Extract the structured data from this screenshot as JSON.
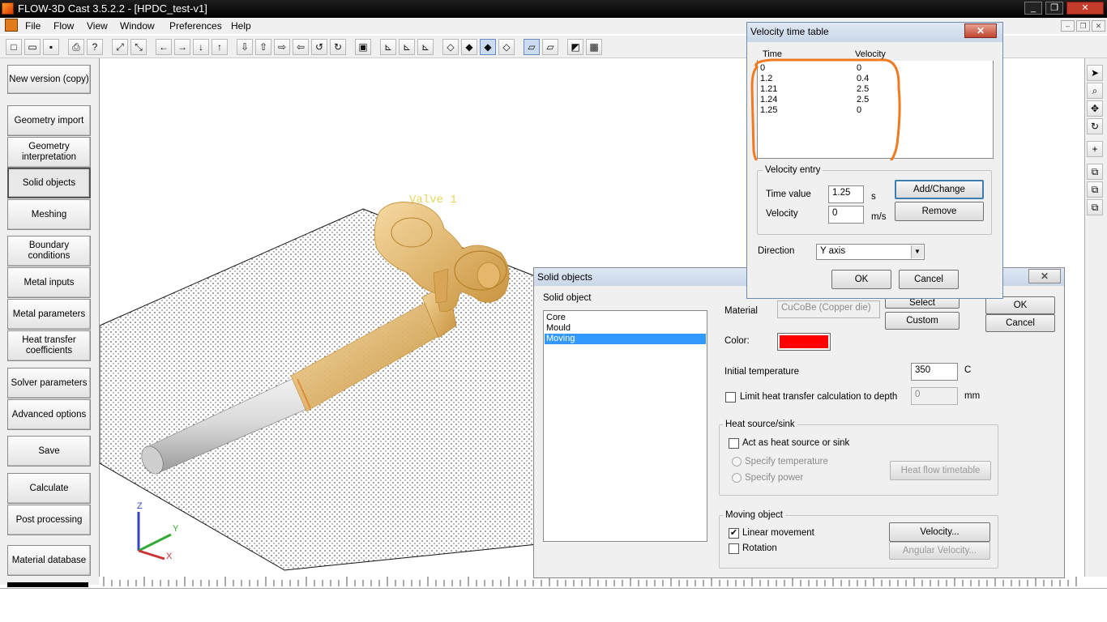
{
  "window": {
    "title": "FLOW-3D Cast 3.5.2.2 - [HPDC_test-v1]"
  },
  "menu": [
    "File",
    "Flow",
    "View",
    "Window",
    "Preferences",
    "Help"
  ],
  "left_panel": {
    "buttons": [
      "New version (copy)",
      "Geometry import",
      "Geometry interpretation",
      "Solid objects",
      "Meshing",
      "Boundary conditions",
      "Metal inputs",
      "Metal parameters",
      "Heat transfer coefficients",
      "Solver parameters",
      "Advanced options",
      "Save",
      "Calculate",
      "Post processing",
      "Material database"
    ],
    "active": "Solid objects"
  },
  "viewport": {
    "label": "Valve 1",
    "axes": {
      "z": "Z",
      "y": "Y",
      "x": "X"
    }
  },
  "velocity_dialog": {
    "title": "Velocity time table",
    "close": "✕",
    "headers": {
      "time": "Time",
      "velocity": "Velocity"
    },
    "rows": [
      {
        "time": "0",
        "velocity": "0"
      },
      {
        "time": "1.2",
        "velocity": "0.4"
      },
      {
        "time": "1.21",
        "velocity": "2.5"
      },
      {
        "time": "1.24",
        "velocity": "2.5"
      },
      {
        "time": "1.25",
        "velocity": "0"
      }
    ],
    "entry_group": "Velocity entry",
    "time_label": "Time value",
    "time_value": "1.25",
    "time_unit": "s",
    "velocity_label": "Velocity",
    "velocity_value": "0",
    "velocity_unit": "m/s",
    "add_change": "Add/Change",
    "remove": "Remove",
    "direction_label": "Direction",
    "direction_value": "Y axis",
    "ok": "OK",
    "cancel": "Cancel",
    "highlight_color": "#f07a20"
  },
  "solid_dialog": {
    "title": "Solid objects",
    "close": "✕",
    "list_label": "Solid object",
    "objects": [
      "Core",
      "Mould",
      "Moving"
    ],
    "selected": "Moving",
    "material_label": "Material",
    "material_value": "CuCoBe (Copper die)",
    "select": "Select",
    "custom": "Custom",
    "ok": "OK",
    "cancel": "Cancel",
    "color_label": "Color:",
    "color_value": "#ff0000",
    "init_temp_label": "Initial temperature",
    "init_temp_value": "350",
    "init_temp_unit": "C",
    "limit_label": "Limit heat transfer calculation to depth",
    "limit_value": "0",
    "limit_unit": "mm",
    "heat_group": "Heat source/sink",
    "act_label": "Act as heat source or sink",
    "spec_temp": "Specify temperature",
    "spec_power": "Specify power",
    "heat_flow": "Heat flow timetable",
    "moving_group": "Moving object",
    "linear_label": "Linear movement",
    "linear_checked": true,
    "rotation_label": "Rotation",
    "velocity_btn": "Velocity...",
    "angular_btn": "Angular Velocity..."
  }
}
